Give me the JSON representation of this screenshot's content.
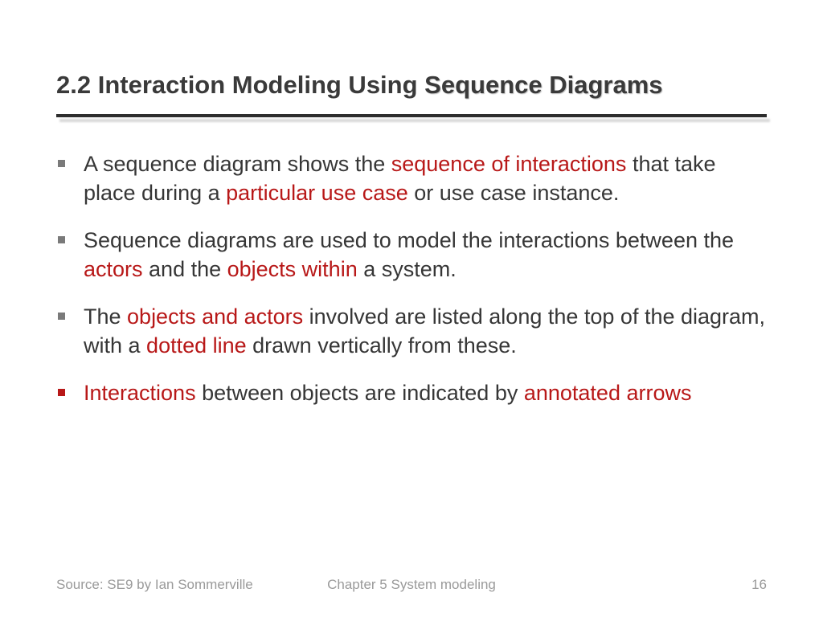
{
  "title": {
    "prefix": "2.2 Interaction Modeling Using ",
    "emph": "Sequence Diagrams"
  },
  "bullets": [
    {
      "marker": "gray",
      "parts": [
        {
          "t": "A sequence diagram shows the ",
          "hl": false
        },
        {
          "t": "sequence of interactions",
          "hl": true
        },
        {
          "t": " that take place during a ",
          "hl": false
        },
        {
          "t": "particular use case",
          "hl": true
        },
        {
          "t": " or use case instance.",
          "hl": false
        }
      ]
    },
    {
      "marker": "gray",
      "parts": [
        {
          "t": "Sequence diagrams are used to model the interactions between the ",
          "hl": false
        },
        {
          "t": "actors",
          "hl": true
        },
        {
          "t": " and the ",
          "hl": false
        },
        {
          "t": "objects within ",
          "hl": true
        },
        {
          "t": "a system.",
          "hl": false
        }
      ]
    },
    {
      "marker": "gray",
      "parts": [
        {
          "t": "The ",
          "hl": false
        },
        {
          "t": "objects and actors ",
          "hl": true
        },
        {
          "t": "involved are listed along the top of the diagram, with a ",
          "hl": false
        },
        {
          "t": "dotted line ",
          "hl": true
        },
        {
          "t": "drawn vertically from these.",
          "hl": false
        }
      ]
    },
    {
      "marker": "red",
      "parts": [
        {
          "t": "Interactions ",
          "hl": true
        },
        {
          "t": "between objects are indicated by ",
          "hl": false
        },
        {
          "t": "annotated arrows",
          "hl": true
        }
      ]
    }
  ],
  "footer": {
    "left": "Source: SE9 by Ian Sommerville",
    "center": "Chapter 5 System modeling",
    "right": "16"
  }
}
